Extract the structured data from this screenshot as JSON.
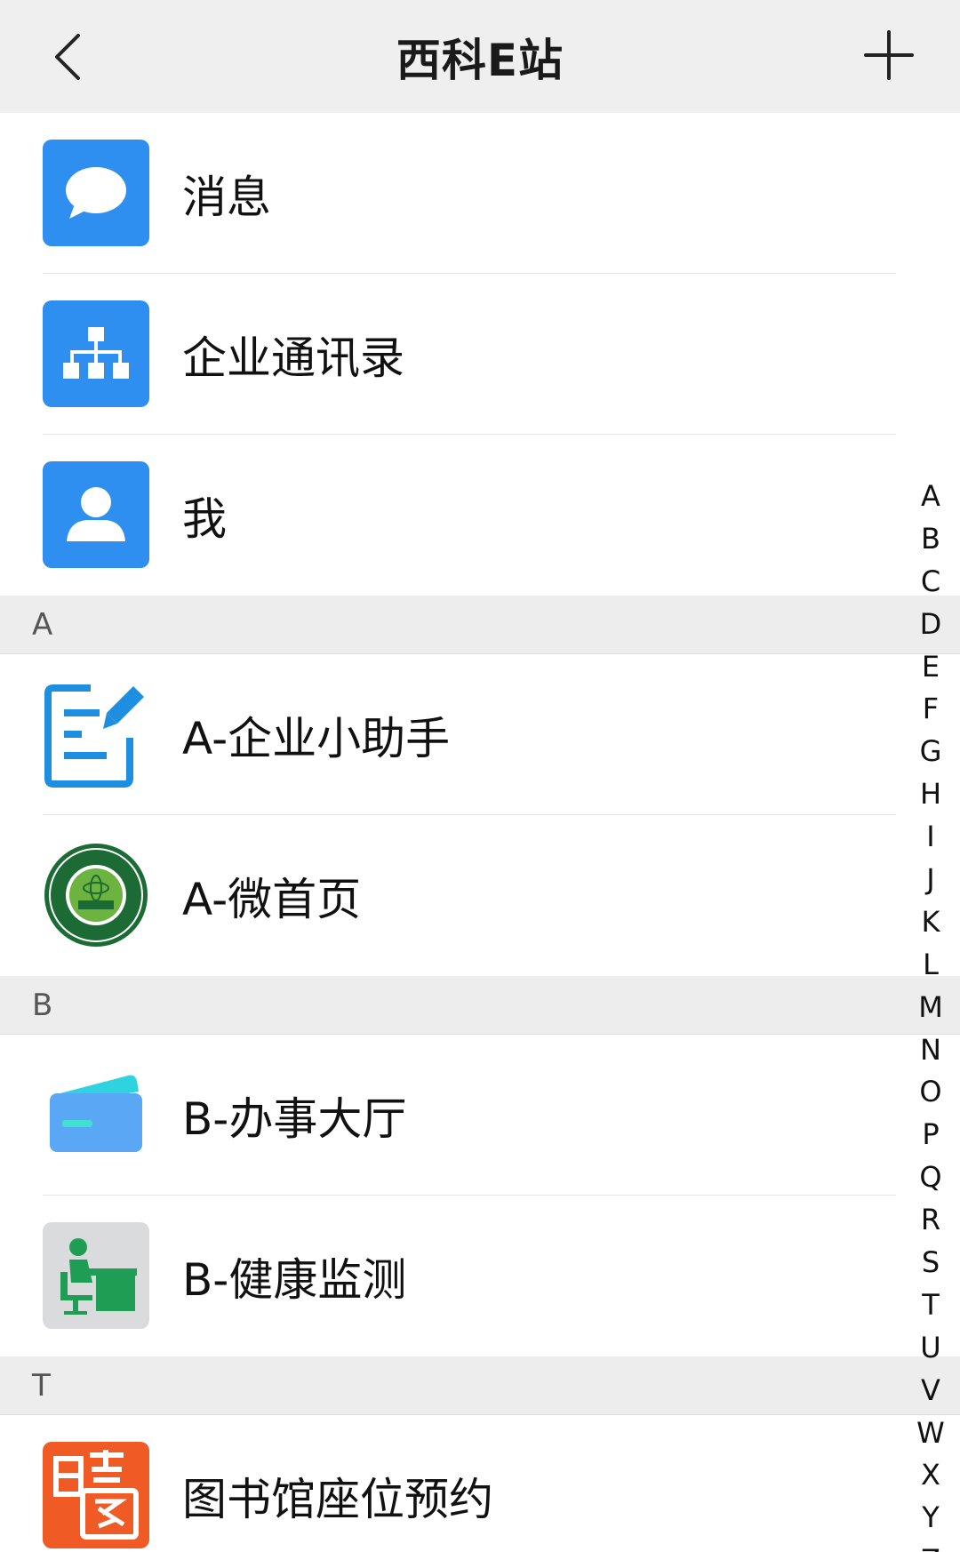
{
  "header": {
    "title": "西科E站"
  },
  "main_items": [
    {
      "label": "消息",
      "icon": "chat-bubble-icon"
    },
    {
      "label": "企业通讯录",
      "icon": "org-chart-icon"
    },
    {
      "label": "我",
      "icon": "person-icon"
    }
  ],
  "sections": [
    {
      "letter": "A",
      "items": [
        {
          "label": "A-企业小助手",
          "icon": "document-pin-icon"
        },
        {
          "label": "A-微首页",
          "icon": "university-seal-icon"
        }
      ]
    },
    {
      "letter": "B",
      "items": [
        {
          "label": "B-办事大厅",
          "icon": "card-icon"
        },
        {
          "label": "B-健康监测",
          "icon": "desk-person-icon"
        }
      ]
    },
    {
      "letter": "T",
      "items": [
        {
          "label": "图书馆座位预约",
          "icon": "xiaotu-icon"
        }
      ]
    }
  ],
  "index_letters": [
    "A",
    "B",
    "C",
    "D",
    "E",
    "F",
    "G",
    "H",
    "I",
    "J",
    "K",
    "L",
    "M",
    "N",
    "O",
    "P",
    "Q",
    "R",
    "S",
    "T",
    "U",
    "V",
    "W",
    "X",
    "Y",
    "Z"
  ],
  "colors": {
    "accent_blue": "#2f8ff0",
    "header_bg": "#efefef",
    "section_bg": "#ededed",
    "orange": "#f05a25",
    "green": "#1f9d55"
  }
}
